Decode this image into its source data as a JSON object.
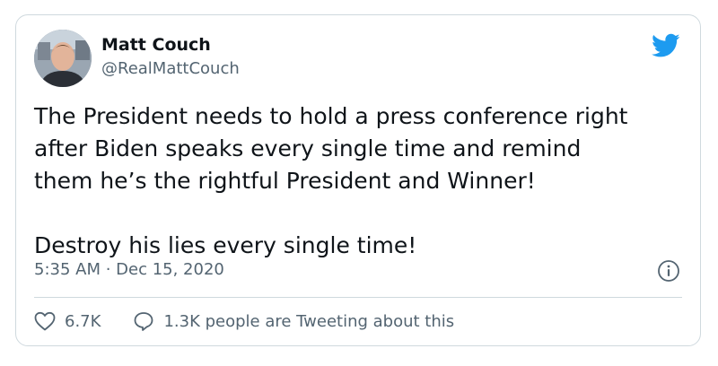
{
  "author": {
    "name": "Matt Couch",
    "handle": "@RealMattCouch"
  },
  "tweet": {
    "text": "The President needs to hold a press conference right\nafter Biden speaks every single time and remind\nthem he’s the rightful President and Winner!\n\nDestroy his lies every single time!",
    "timestamp": "5:35 AM · Dec 15, 2020"
  },
  "actions": {
    "likes": "6.7K",
    "conversation": "1.3K people are Tweeting about this"
  },
  "colors": {
    "brand": "#1d9bf0",
    "text": "#0f1419",
    "muted": "#536471",
    "border": "#cfd9de"
  },
  "icons": {
    "logo": "twitter-bird-icon",
    "info": "info-icon",
    "like": "heart-icon",
    "conversation": "speech-bubble-icon"
  }
}
